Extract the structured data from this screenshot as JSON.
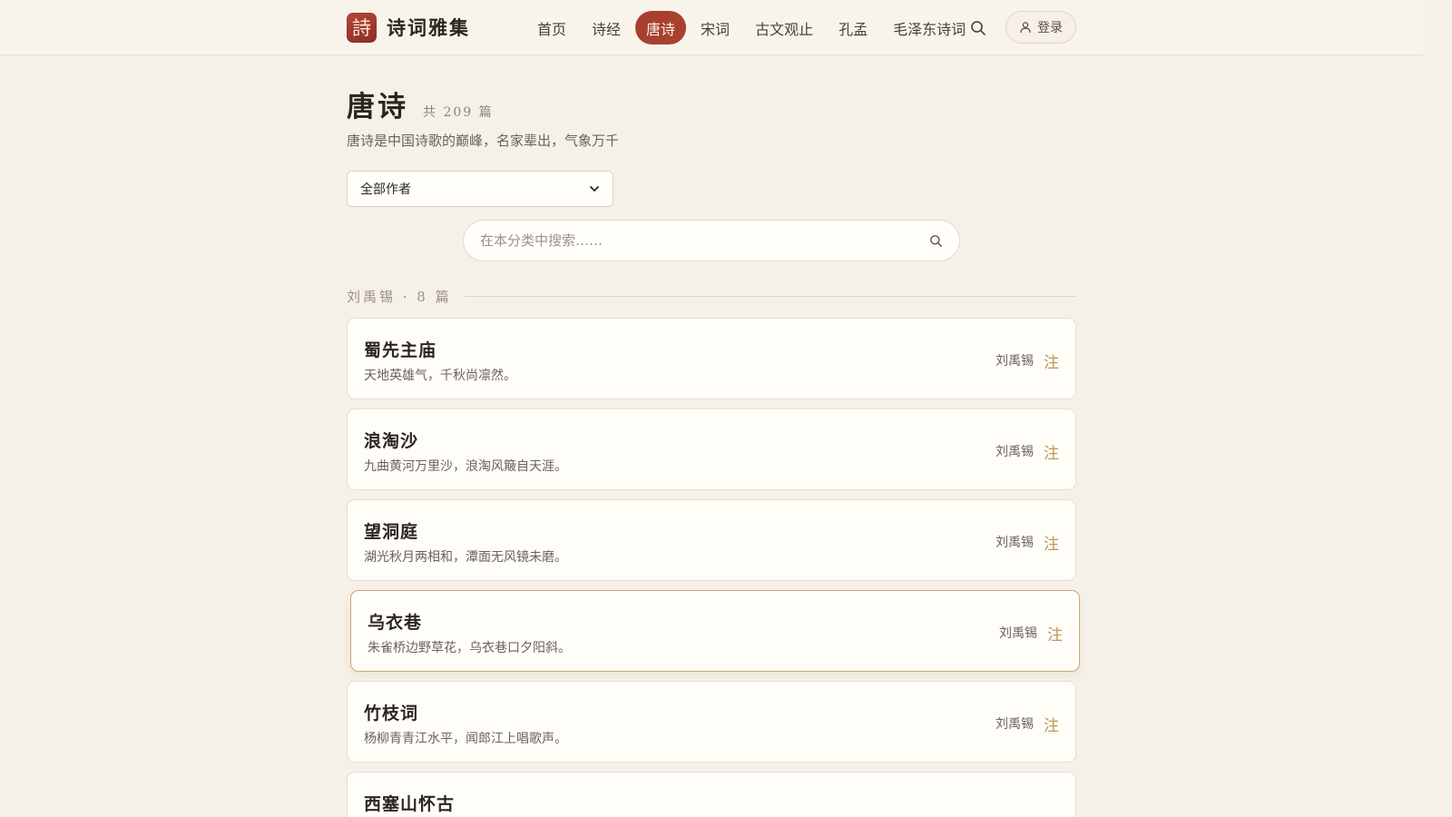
{
  "brand": {
    "logo_char": "詩",
    "name": "诗词雅集"
  },
  "nav": {
    "items": [
      {
        "label": "首页",
        "active": false
      },
      {
        "label": "诗经",
        "active": false
      },
      {
        "label": "唐诗",
        "active": true
      },
      {
        "label": "宋词",
        "active": false
      },
      {
        "label": "古文观止",
        "active": false
      },
      {
        "label": "孔孟",
        "active": false
      },
      {
        "label": "毛泽东诗词",
        "active": false
      }
    ],
    "search_icon": "search-icon",
    "login_label": "登录"
  },
  "page": {
    "title": "唐诗",
    "count": "共 209 篇",
    "description": "唐诗是中国诗歌的巅峰，名家辈出，气象万千"
  },
  "filter": {
    "author_selected": "全部作者"
  },
  "search": {
    "placeholder": "在本分类中搜索……"
  },
  "group": {
    "label": "刘禹锡 · 8 篇"
  },
  "poems": [
    {
      "title": "蜀先主庙",
      "excerpt": "天地英雄气，千秋尚凛然。",
      "author": "刘禹锡",
      "note": "注"
    },
    {
      "title": "浪淘沙",
      "excerpt": "九曲黄河万里沙，浪淘风簸自天涯。",
      "author": "刘禹锡",
      "note": "注"
    },
    {
      "title": "望洞庭",
      "excerpt": "湖光秋月两相和，潭面无风镜未磨。",
      "author": "刘禹锡",
      "note": "注"
    },
    {
      "title": "乌衣巷",
      "excerpt": "朱雀桥边野草花，乌衣巷口夕阳斜。",
      "author": "刘禹锡",
      "note": "注"
    },
    {
      "title": "竹枝词",
      "excerpt": "杨柳青青江水平，闻郎江上唱歌声。",
      "author": "刘禹锡",
      "note": "注"
    },
    {
      "title": "西塞山怀古",
      "excerpt": "",
      "author": "",
      "note": ""
    }
  ],
  "colors": {
    "accent": "#a8402f",
    "background": "#f6f1e8",
    "note": "#c0955a"
  }
}
